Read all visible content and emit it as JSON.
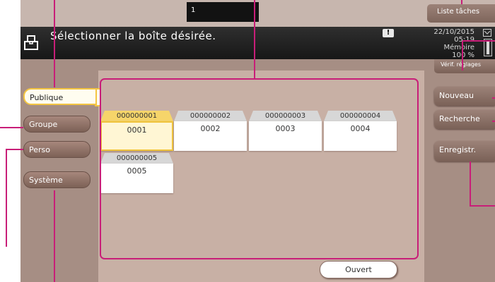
{
  "topbar": {
    "job_field_value": "1",
    "job_list_label": "Liste tâches"
  },
  "header": {
    "title": "Sélectionner la boîte désirée.",
    "alert_symbol": "!",
    "date": "22/10/2015",
    "time": "05:19",
    "memory_label": "Mémoire",
    "memory_percent": "100 %",
    "check_settings_label": "Vérif. réglages"
  },
  "tabs": [
    {
      "label": "Publique",
      "active": true
    },
    {
      "label": "Groupe",
      "active": false
    },
    {
      "label": "Perso",
      "active": false
    },
    {
      "label": "Système",
      "active": false
    }
  ],
  "boxes": [
    {
      "number": "000000001",
      "name": "0001",
      "selected": true
    },
    {
      "number": "000000002",
      "name": "0002",
      "selected": false
    },
    {
      "number": "000000003",
      "name": "0003",
      "selected": false
    },
    {
      "number": "000000004",
      "name": "0004",
      "selected": false
    },
    {
      "number": "000000005",
      "name": "0005",
      "selected": false
    }
  ],
  "open_button_label": "Ouvert",
  "side_buttons": {
    "new_label": "Nouveau",
    "search_label": "Recherche",
    "register_label": "Enregistr."
  },
  "colors": {
    "accent_callout": "#c81e78",
    "selected_tab_border": "#f4c542",
    "panel_background": "#a68e84"
  },
  "icons": [
    "box-icon",
    "alert-icon",
    "memory-icon"
  ]
}
